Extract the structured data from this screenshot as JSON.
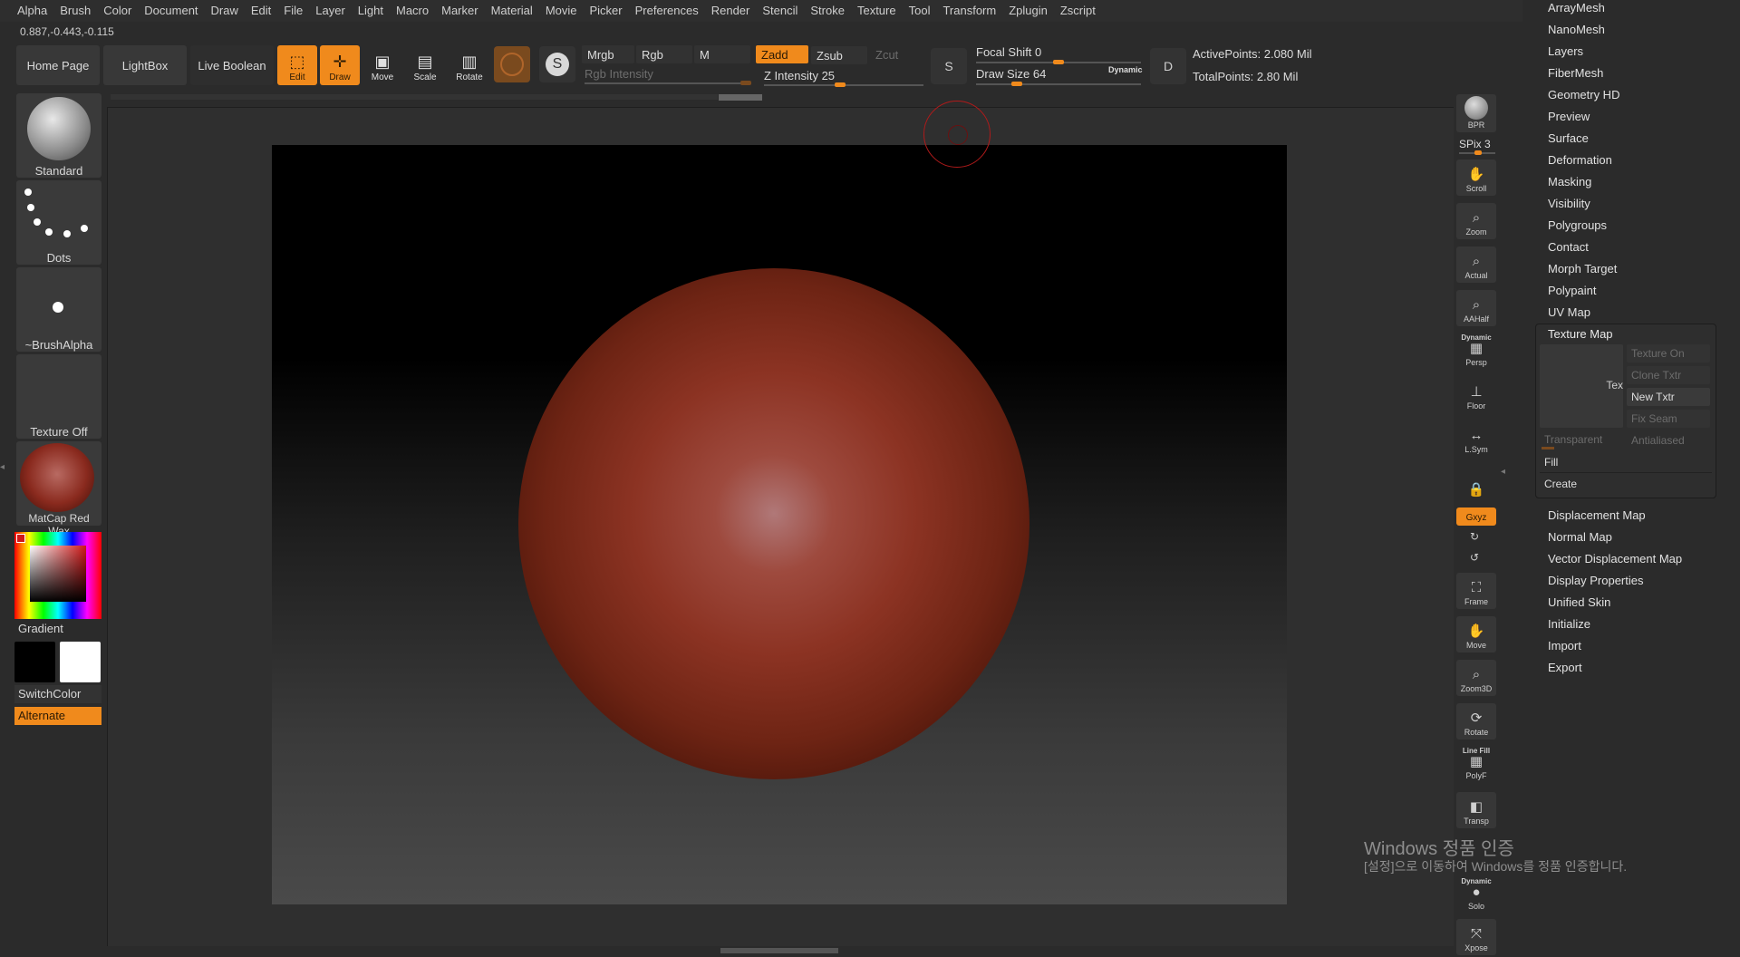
{
  "menu": [
    "Alpha",
    "Brush",
    "Color",
    "Document",
    "Draw",
    "Edit",
    "File",
    "Layer",
    "Light",
    "Macro",
    "Marker",
    "Material",
    "Movie",
    "Picker",
    "Preferences",
    "Render",
    "Stencil",
    "Stroke",
    "Texture",
    "Tool",
    "Transform",
    "Zplugin",
    "Zscript"
  ],
  "coords": "0.887,-0.443,-0.115",
  "toolbar": {
    "home_page": "Home Page",
    "lightbox": "LightBox",
    "live_boolean": "Live Boolean",
    "edit": "Edit",
    "draw": "Draw",
    "move": "Move",
    "scale": "Scale",
    "rotate": "Rotate",
    "mrgb": "Mrgb",
    "rgb": "Rgb",
    "m": "M",
    "zadd": "Zadd",
    "zsub": "Zsub",
    "zcut": "Zcut",
    "rgb_intensity": "Rgb Intensity",
    "z_intensity": "Z Intensity 25",
    "focal_shift": "Focal Shift 0",
    "draw_size": "Draw Size 64",
    "dynamic": "Dynamic",
    "active_points": "ActivePoints: 2.080 Mil",
    "total_points": "TotalPoints: 2.80 Mil",
    "s_label": "S",
    "d_label": "D"
  },
  "left_shelf": {
    "brush": "Standard",
    "stroke": "Dots",
    "alpha": "~BrushAlpha",
    "texture": "Texture Off",
    "material": "MatCap Red Wax",
    "gradient": "Gradient",
    "switch_color": "SwitchColor",
    "alternate": "Alternate"
  },
  "right_toolbar": {
    "bpr": "BPR",
    "spix": "SPix 3",
    "scroll": "Scroll",
    "zoom": "Zoom",
    "actual": "Actual",
    "aahalf": "AAHalf",
    "dynamic": "Dynamic",
    "persp": "Persp",
    "floor": "Floor",
    "lsym": "L.Sym",
    "xyz": "Gxyz",
    "frame": "Frame",
    "move": "Move",
    "zoom3d": "Zoom3D",
    "rotate": "Rotate",
    "line_fill": "Line Fill",
    "polyf": "PolyF",
    "transp": "Transp",
    "dynamic2": "Dynamic",
    "solo": "Solo",
    "xpose": "Xpose"
  },
  "palette": {
    "items_top": [
      "ArrayMesh",
      "NanoMesh",
      "Layers",
      "FiberMesh",
      "Geometry HD",
      "Preview",
      "Surface",
      "Deformation",
      "Masking",
      "Visibility",
      "Polygroups",
      "Contact",
      "Morph Target",
      "Polypaint",
      "UV Map"
    ],
    "texture_map": {
      "title": "Texture Map",
      "preview_text": "Tex",
      "texture_on": "Texture On",
      "clone_txtr": "Clone Txtr",
      "new_txtr": "New Txtr",
      "fix_seam": "Fix Seam",
      "transparent": "Transparent",
      "antialiased": "Antialiased",
      "fill": "Fill",
      "create": "Create"
    },
    "items_bottom": [
      "Displacement Map",
      "Normal Map",
      "Vector Displacement Map",
      "Display Properties",
      "Unified Skin",
      "Initialize",
      "Import",
      "Export"
    ]
  },
  "watermark": {
    "line1": "Windows 정품 인증",
    "line2": "[설정]으로 이동하여 Windows를 정품 인증합니다."
  },
  "colors": {
    "accent": "#f08a1c",
    "background": "#2b2b2b"
  }
}
